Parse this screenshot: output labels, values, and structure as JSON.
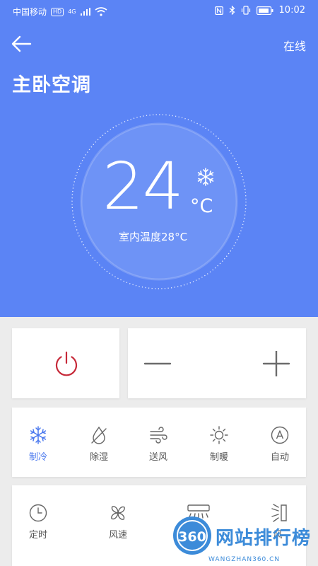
{
  "status_bar": {
    "carrier": "中国移动",
    "hd": "HD",
    "network": "4G",
    "time": "10:02"
  },
  "header": {
    "online": "在线",
    "title": "主卧空调"
  },
  "thermostat": {
    "set_temp": "24",
    "unit": "°C",
    "indoor_label": "室内温度28°C"
  },
  "modes": [
    {
      "label": "制冷",
      "icon": "snowflake-icon",
      "active": true
    },
    {
      "label": "除湿",
      "icon": "dehumidify-icon",
      "active": false
    },
    {
      "label": "送风",
      "icon": "wind-icon",
      "active": false
    },
    {
      "label": "制暖",
      "icon": "sun-icon",
      "active": false
    },
    {
      "label": "自动",
      "icon": "auto-icon",
      "active": false
    }
  ],
  "functions": [
    {
      "label": "定时",
      "icon": "clock-icon"
    },
    {
      "label": "风速",
      "icon": "fan-icon"
    },
    {
      "label": "风",
      "icon": "swing-icon"
    },
    {
      "label": "风",
      "icon": "swing-side-icon"
    }
  ],
  "watermark": {
    "logo_text": "360",
    "text": "网站排行榜",
    "url": "WANGZHAN360.CN"
  },
  "colors": {
    "hero": "#5b84f5",
    "accent": "#4a78ee",
    "power": "#c62838"
  }
}
